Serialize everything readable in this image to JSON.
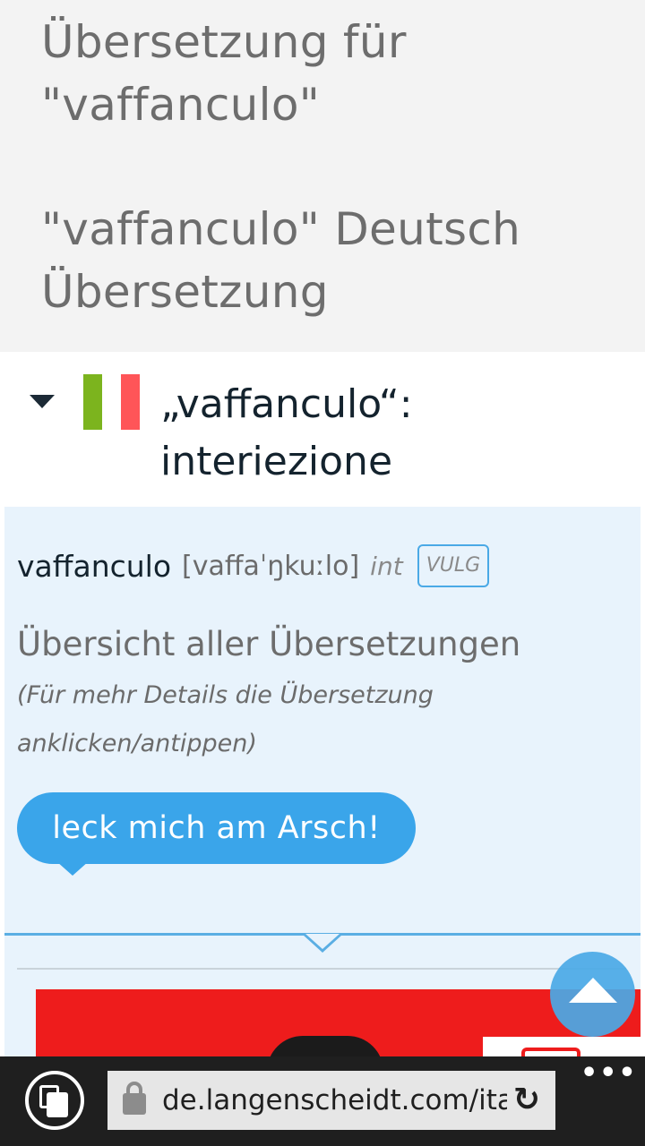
{
  "header": {
    "title_line1": "Übersetzung für",
    "title_line2": "\"vaffanculo\"",
    "subtitle_line1": "\"vaffanculo\" Deutsch",
    "subtitle_line2": "Übersetzung"
  },
  "entry": {
    "flag_icon": "italy-flag-icon",
    "title_line1": "„vaffanculo“:",
    "title_line2": "interiezione",
    "headword": "vaffanculo",
    "ipa": "[vaffaˈŋkuːlo]",
    "pos": "int",
    "register_tag": "VULG",
    "overview_title": "Übersicht aller Übersetzungen",
    "hint": "(Für mehr Details die Übersetzung anklicken/antippen)",
    "translation": "leck mich am Arsch!"
  },
  "browser": {
    "url": "de.langenscheidt.com/ita",
    "reload_glyph": "↻",
    "more_glyph": "•••",
    "tabs_icon": "tabs-icon",
    "lock_icon": "lock-icon"
  },
  "colors": {
    "accent": "#3aa5ea",
    "header_bg": "#f3f3f3",
    "box_bg": "#e8f3fc",
    "ad_red": "#ee1c1c"
  }
}
